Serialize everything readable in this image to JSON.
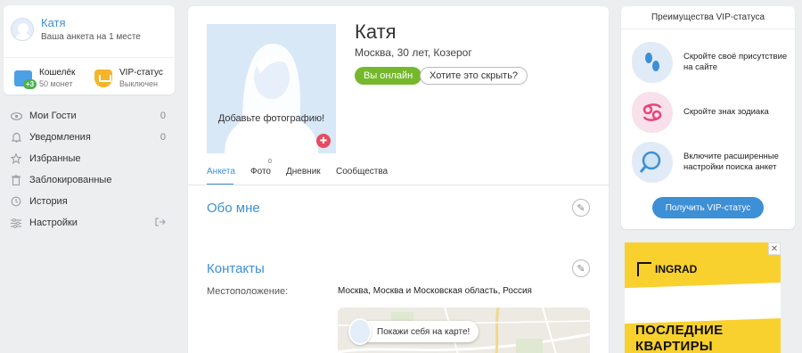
{
  "user": {
    "name": "Катя",
    "place": "Ваша анкета на 1 месте"
  },
  "wallet": {
    "title": "Кошелёк",
    "amount": "50 монет",
    "badge": "+3"
  },
  "vip_status": {
    "title": "VIP-статус",
    "state": "Выключен"
  },
  "menu": [
    {
      "label": "Мои Гости",
      "count": "0",
      "icon": "eye-icon"
    },
    {
      "label": "Уведомления",
      "count": "0",
      "icon": "bell-icon"
    },
    {
      "label": "Избранные",
      "count": "",
      "icon": "star-icon"
    },
    {
      "label": "Заблокированные",
      "count": "",
      "icon": "trash-icon"
    },
    {
      "label": "История",
      "count": "",
      "icon": "history-icon"
    },
    {
      "label": "Настройки",
      "count": "",
      "icon": "settings-icon"
    }
  ],
  "profile": {
    "name": "Катя",
    "info": "Москва, 30 лет, Козерог",
    "photo_text": "Добавьте фотографию!",
    "online_button": "Вы онлайн",
    "hide_button": "Хотите это скрыть?"
  },
  "tabs": [
    {
      "label": "Анкета",
      "active": true
    },
    {
      "label": "Фото",
      "count": "0"
    },
    {
      "label": "Дневник"
    },
    {
      "label": "Сообщества"
    }
  ],
  "sections": {
    "about_title": "Обо мне",
    "contacts_title": "Контакты",
    "location_label": "Местоположение:",
    "location_value": "Москва, Москва и Московская область, Россия",
    "map_button": "Покажи себя на карте!"
  },
  "vip_panel": {
    "title": "Преимущества VIP-статуса",
    "benefits": [
      {
        "text": "Скройте своё присутствие на сайте",
        "icon": "footprints-icon"
      },
      {
        "text": "Скройте знак зодиака",
        "icon": "zodiac-cancer-icon"
      },
      {
        "text": "Включите расширенные настройки поиска анкет",
        "icon": "magnifier-icon"
      }
    ],
    "button": "Получить VIP-статус"
  },
  "ad": {
    "brand": "INGRAD",
    "headline_1": "ПОСЛЕДНИЕ",
    "headline_2": "КВАРТИРЫ",
    "close": "✕"
  },
  "colors": {
    "accent": "#3d8fd6",
    "online": "#75b82c",
    "page_bg": "#eceef0",
    "ad_bg": "#f8d12e"
  }
}
